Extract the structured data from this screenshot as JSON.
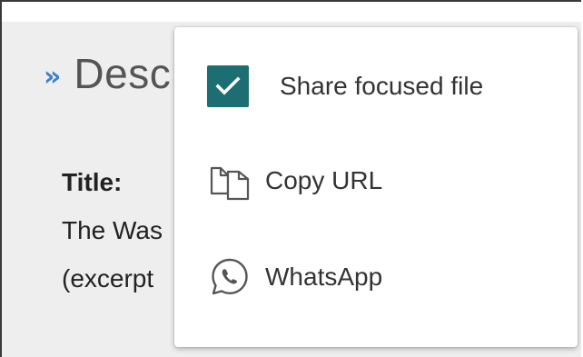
{
  "panel": {
    "header_chevron": "»",
    "header_text": "Desc",
    "title_label": "Title:",
    "description_line1": "The Was",
    "description_line2": "(excerpt"
  },
  "share_menu": {
    "items": [
      {
        "label": "Share focused file",
        "icon": "checkbox-checked-icon",
        "checked": true
      },
      {
        "label": "Copy URL",
        "icon": "copy-icon"
      },
      {
        "label": "WhatsApp",
        "icon": "whatsapp-icon"
      }
    ]
  },
  "colors": {
    "checkbox_fill": "#1d6e73",
    "chevron": "#3d7fc7",
    "panel_background": "#eeeeee"
  }
}
